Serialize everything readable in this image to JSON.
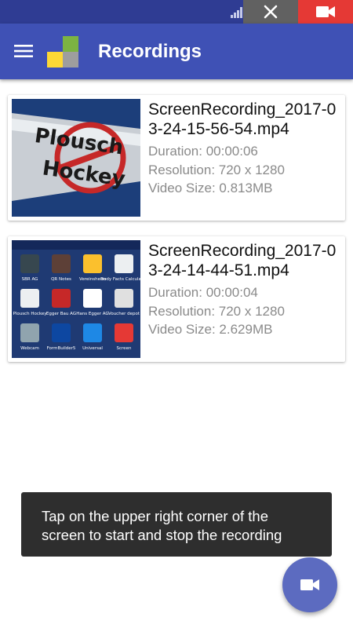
{
  "status_bar": {
    "signal_icon": "signal-icon",
    "overlay_close_icon": "close-icon",
    "overlay_record_icon": "videocam-icon"
  },
  "app_bar": {
    "menu_icon": "menu-icon",
    "title": "Recordings"
  },
  "recordings": [
    {
      "file_name": "ScreenRecording_2017-03-24-15-56-54.mp4",
      "duration": "Duration: 00:00:06",
      "resolution": "Resolution: 720 x 1280",
      "size": "Video Size: 0.813MB",
      "thumb_text_1": "Plousch",
      "thumb_text_2": "Hockey"
    },
    {
      "file_name": "ScreenRecording_2017-03-24-14-44-51.mp4",
      "duration": "Duration: 00:00:04",
      "resolution": "Resolution: 720 x 1280",
      "size": "Video Size: 2.629MB",
      "thumb_labels": [
        "SBR AG",
        "QR Notes",
        "Vereinsheim",
        "Body Facts Calculator",
        "Plousch Hockey",
        "Egger Bau AG",
        "Hans Egger AG",
        "Voucher depot",
        "Webcam",
        "FormBuilder5",
        "Universal",
        "Screen"
      ]
    }
  ],
  "toast": {
    "text": "Tap on the upper right corner of the screen to start and stop the recording"
  },
  "fab": {
    "icon": "videocam-icon"
  },
  "colors": {
    "status_bar": "#2f3c93",
    "app_bar": "#3f51b5",
    "fab": "#5c6bc0",
    "record": "#e53935",
    "toast": "#2e2e2e"
  }
}
